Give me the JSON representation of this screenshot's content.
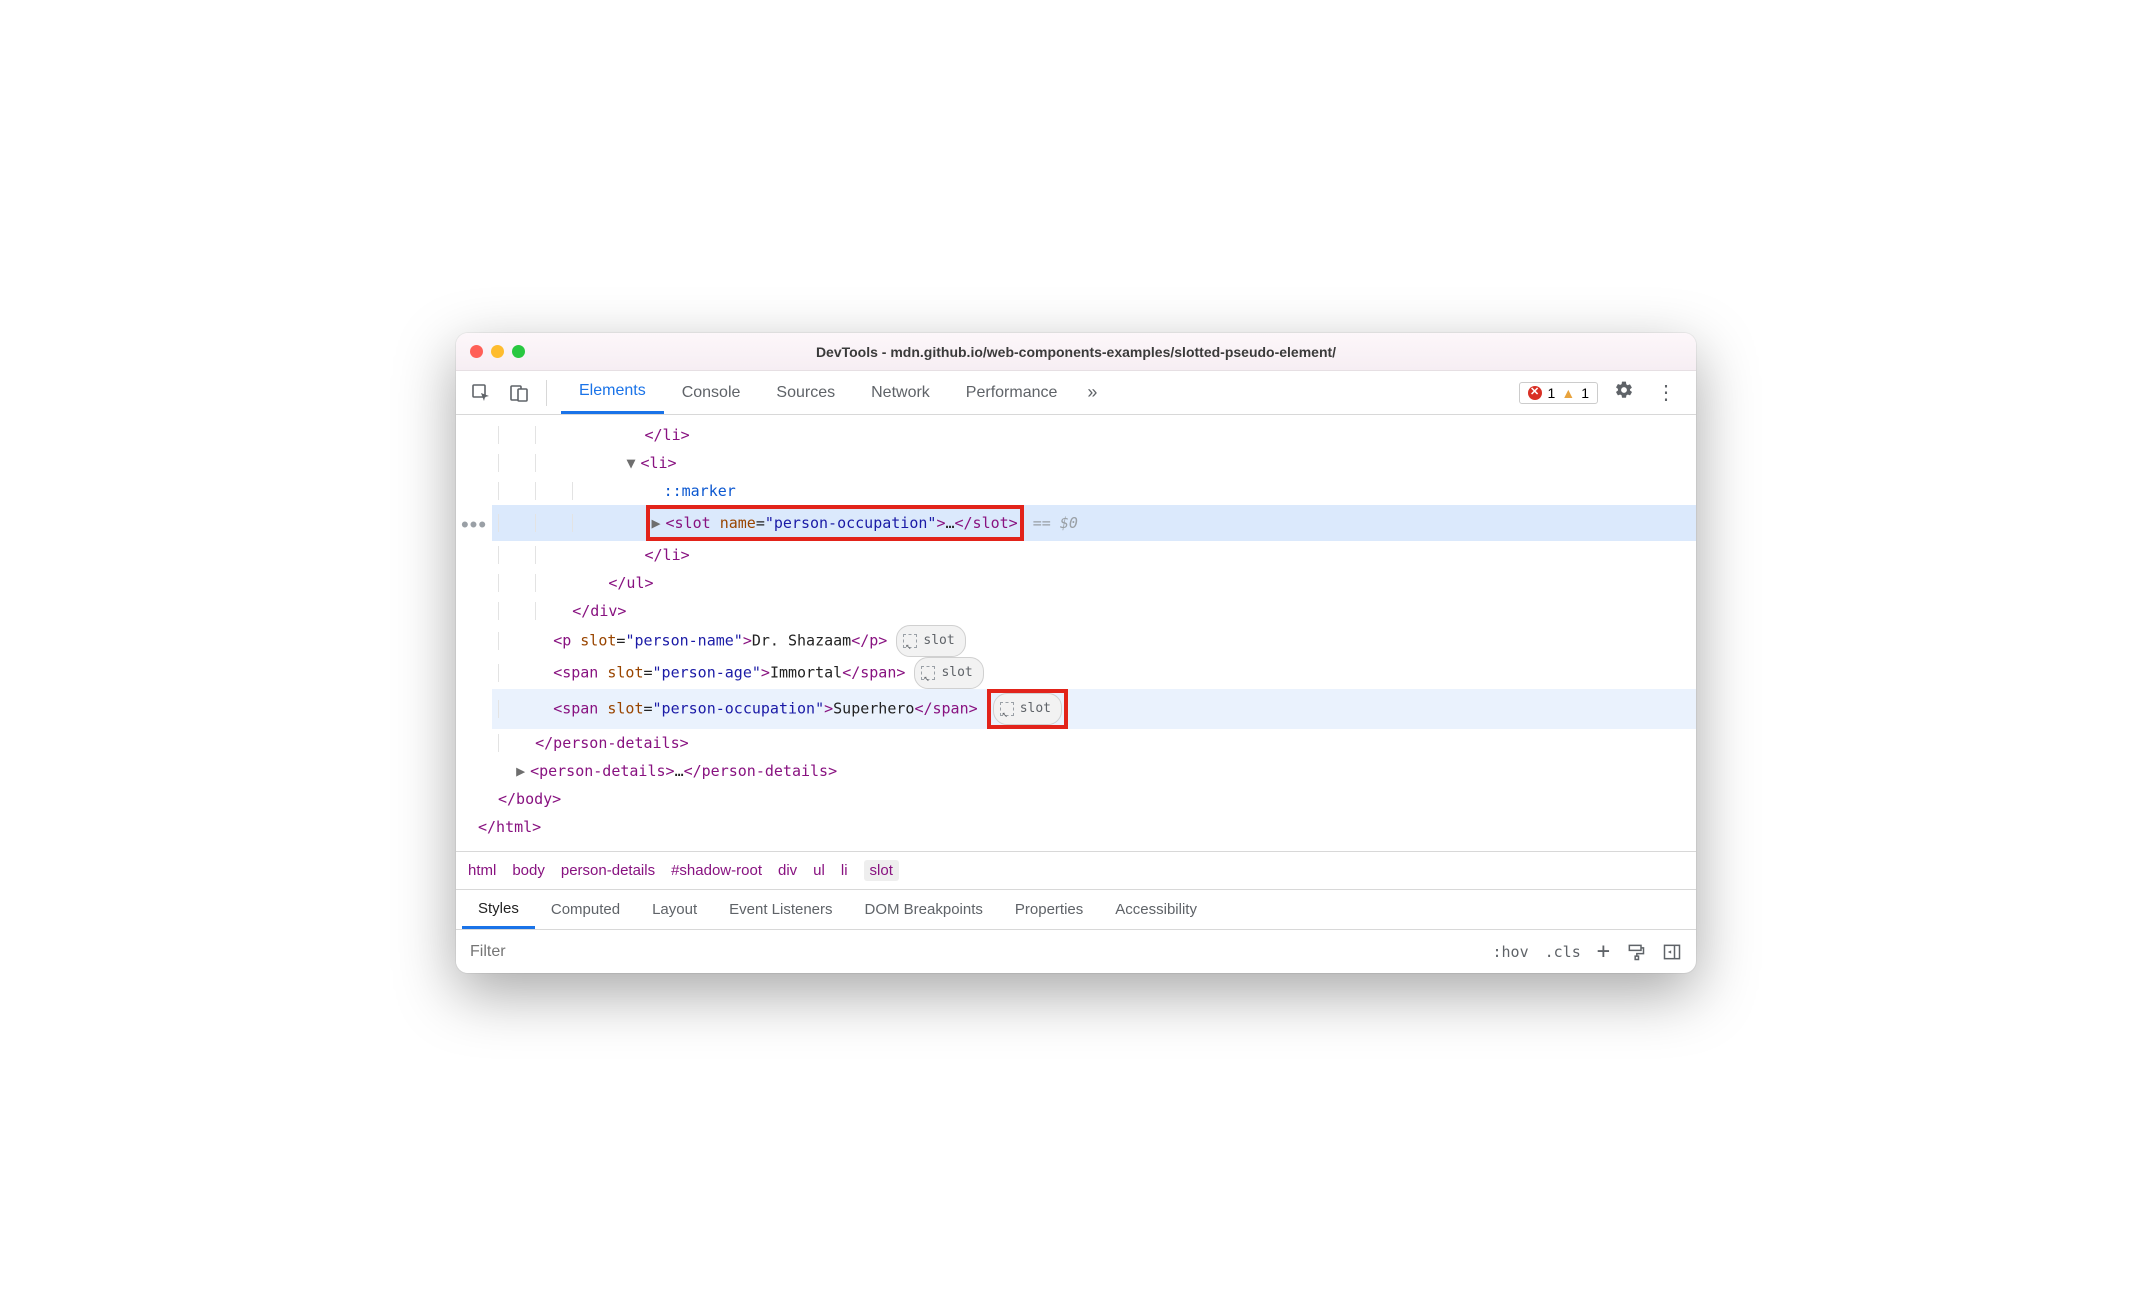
{
  "window": {
    "title": "DevTools - mdn.github.io/web-components-examples/slotted-pseudo-element/"
  },
  "tabs": {
    "elements": "Elements",
    "console": "Console",
    "sources": "Sources",
    "network": "Network",
    "performance": "Performance"
  },
  "toolbar": {
    "errors": "1",
    "warnings": "1"
  },
  "tree": {
    "li_close1": "</li>",
    "li_open": "<li>",
    "marker": "::marker",
    "slot_open_l": "<slot",
    "slot_attr_name": "name",
    "slot_attr_eq": "=",
    "slot_attr_val": "\"person-occupation\"",
    "slot_open_r": ">",
    "slot_ell": "…",
    "slot_close": "</slot>",
    "eq0": " == $0",
    "li_close2": "</li>",
    "ul_close": "</ul>",
    "div_close": "</div>",
    "p_open": "<p ",
    "p_attr_name": "slot",
    "p_attr_val": "\"person-name\"",
    "p_text": "Dr. Shazaam",
    "p_close": "</p>",
    "span1_open": "<span ",
    "span1_attr_val": "\"person-age\"",
    "span1_text": "Immortal",
    "span1_close": "</span>",
    "span2_open": "<span ",
    "span2_attr_val": "\"person-occupation\"",
    "span2_text": "Superhero",
    "span2_close": "</span>",
    "pd_close": "</person-details>",
    "pd2_open": "<person-details>",
    "pd2_ell": "…",
    "pd2_close": "</person-details>",
    "body_close": "</body>",
    "html_close": "</html>",
    "slot_pill": "slot"
  },
  "breadcrumb": {
    "html": "html",
    "body": "body",
    "pd": "person-details",
    "sr": "#shadow-root",
    "div": "div",
    "ul": "ul",
    "li": "li",
    "slot": "slot"
  },
  "subtabs": {
    "styles": "Styles",
    "computed": "Computed",
    "layout": "Layout",
    "el": "Event Listeners",
    "db": "DOM Breakpoints",
    "props": "Properties",
    "acc": "Accessibility"
  },
  "filter": {
    "placeholder": "Filter",
    "hov": ":hov",
    "cls": ".cls"
  }
}
